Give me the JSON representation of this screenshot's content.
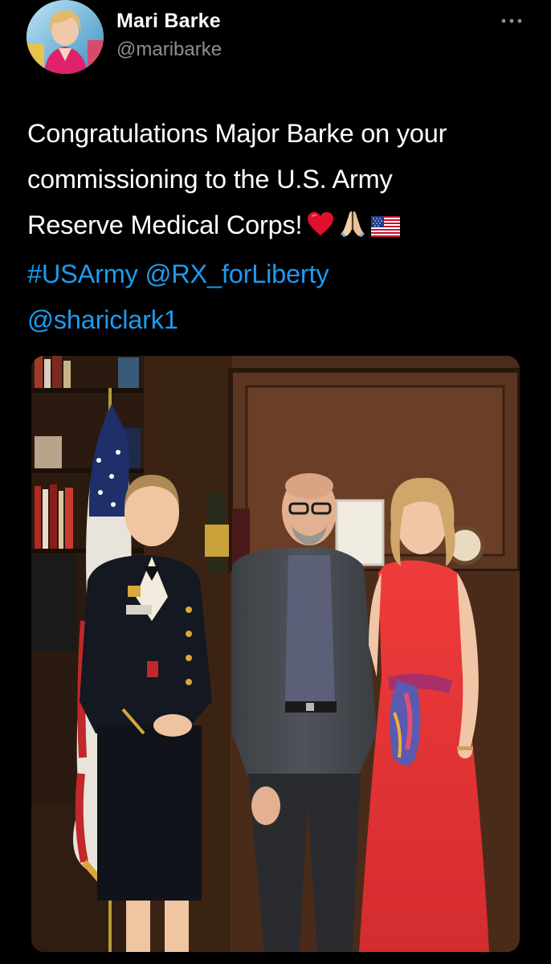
{
  "author": {
    "display_name": "Mari Barke",
    "handle": "@maribarke",
    "avatar_icon": "profile-photo"
  },
  "more_menu": {
    "icon": "more-horizontal-icon"
  },
  "tweet": {
    "line1": "Congratulations Major Barke on your",
    "line2": "commissioning to the U.S. Army",
    "line3": "Reserve Medical Corps!",
    "emojis": [
      "red-heart",
      "folded-hands",
      "us-flag"
    ],
    "hashtag_army": "#USArmy",
    "mention_rx": "@RX_forLiberty",
    "mention_shari": "@shariclark1"
  },
  "media": {
    "type": "photo",
    "subject": "three-people-standing-with-american-flag"
  },
  "colors": {
    "background": "#000000",
    "link": "#1d9bf0",
    "text": "#ffffff",
    "secondary": "#8b9096"
  }
}
